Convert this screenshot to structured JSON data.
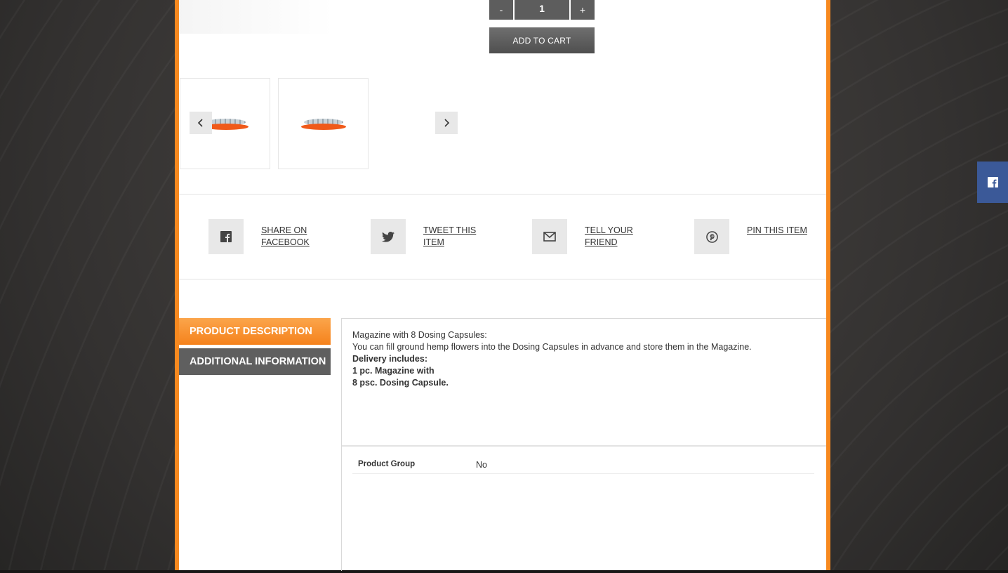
{
  "quantity": {
    "minus_label": "-",
    "value": "1",
    "plus_label": "+"
  },
  "cart": {
    "add_label": "ADD TO CART"
  },
  "gallery": {
    "prev_label": "‹",
    "next_label": "›"
  },
  "share": [
    {
      "label": "SHARE ON FACEBOOK",
      "icon": "facebook-icon"
    },
    {
      "label": "TWEET THIS ITEM",
      "icon": "twitter-icon"
    },
    {
      "label": "TELL YOUR FRIEND",
      "icon": "mail-icon"
    },
    {
      "label": "PIN THIS ITEM",
      "icon": "pinterest-icon"
    }
  ],
  "tabs": [
    {
      "label": "PRODUCT DESCRIPTION"
    },
    {
      "label": "ADDITIONAL INFORMATION"
    }
  ],
  "description": {
    "line1": "Magazine with 8 Dosing Capsules:",
    "line2": "You can fill ground hemp flowers into the Dosing Capsules in advance and store them in the Magazine.",
    "line3": "Delivery includes:",
    "line4": "1 pc. Magazine with",
    "line5": "8 psc. Dosing Capsule."
  },
  "attributes": [
    {
      "label": "Product Group",
      "value": "No"
    }
  ],
  "colors": {
    "accent": "#f7891f",
    "dark_button": "#5d5d5d",
    "facebook": "#3b5998"
  }
}
